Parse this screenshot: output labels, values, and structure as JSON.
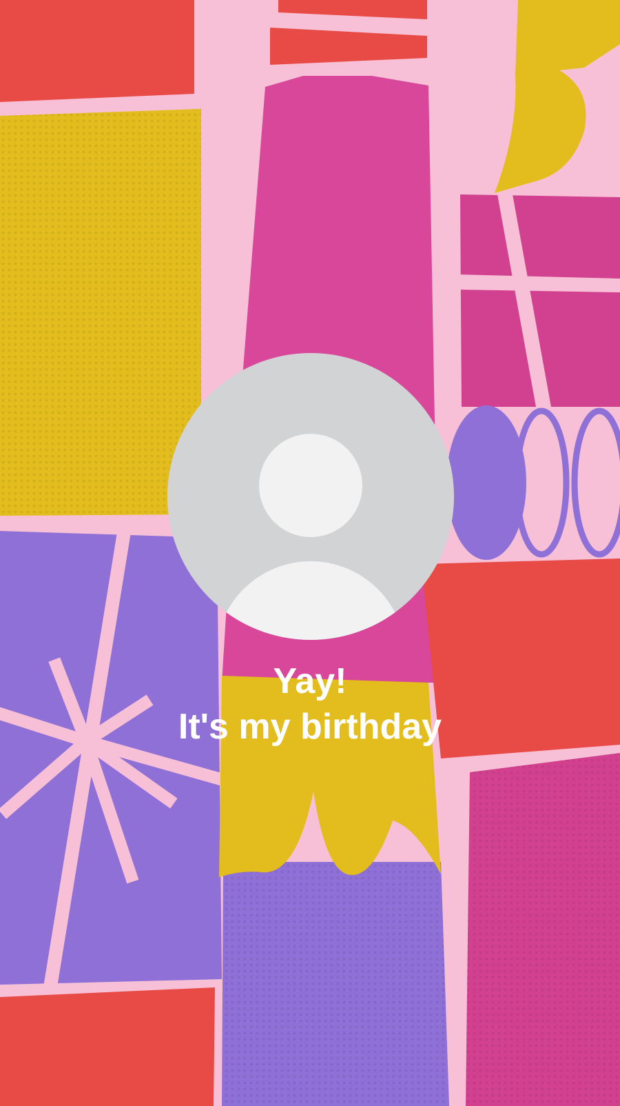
{
  "story": {
    "line1": "Yay!",
    "line2": "It's my birthday"
  },
  "avatar": {
    "icon": "default-profile-icon"
  },
  "colors": {
    "background_pink": "#f7c0d6",
    "red": "#e84a45",
    "yellow": "#e2bd1d",
    "magenta": "#d2418f",
    "purple": "#8e70d6",
    "avatar_gray": "#d2d3d5",
    "avatar_light": "#f2f2f2",
    "text": "#ffffff"
  }
}
